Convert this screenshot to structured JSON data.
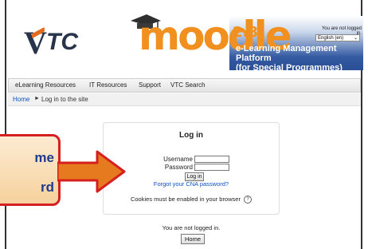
{
  "header": {
    "vtc_logo_text": "VTC",
    "moodle_text": "moodle",
    "moodle_version": "2.8",
    "platform_line1": "e-Learning Management Platform",
    "platform_line2": "(for Special Programmes)",
    "login_status": "You are not logged in.",
    "language_selected": "English (en)"
  },
  "nav": {
    "items": [
      "eLearning Resources",
      "IT Resources",
      "Support",
      "VTC Search"
    ]
  },
  "breadcrumb": {
    "home": "Home",
    "separator": "►",
    "current": "Log in to the site"
  },
  "login_panel": {
    "title": "Log in",
    "username_label": "Username",
    "password_label": "Password",
    "login_button": "Log in",
    "forgot_link": "Forgot your CNA password?",
    "cookies_note": "Cookies must be enabled in your browser",
    "help_icon": "?"
  },
  "footer": {
    "status": "You are not logged in.",
    "home_button": "Home"
  },
  "callout": {
    "text_line1": "me",
    "text_line2": "rd"
  },
  "colors": {
    "moodle_orange": "#f1901e",
    "link_blue": "#0b51c5",
    "callout_border": "#d62020",
    "arrow_fill": "#e67a1f"
  }
}
